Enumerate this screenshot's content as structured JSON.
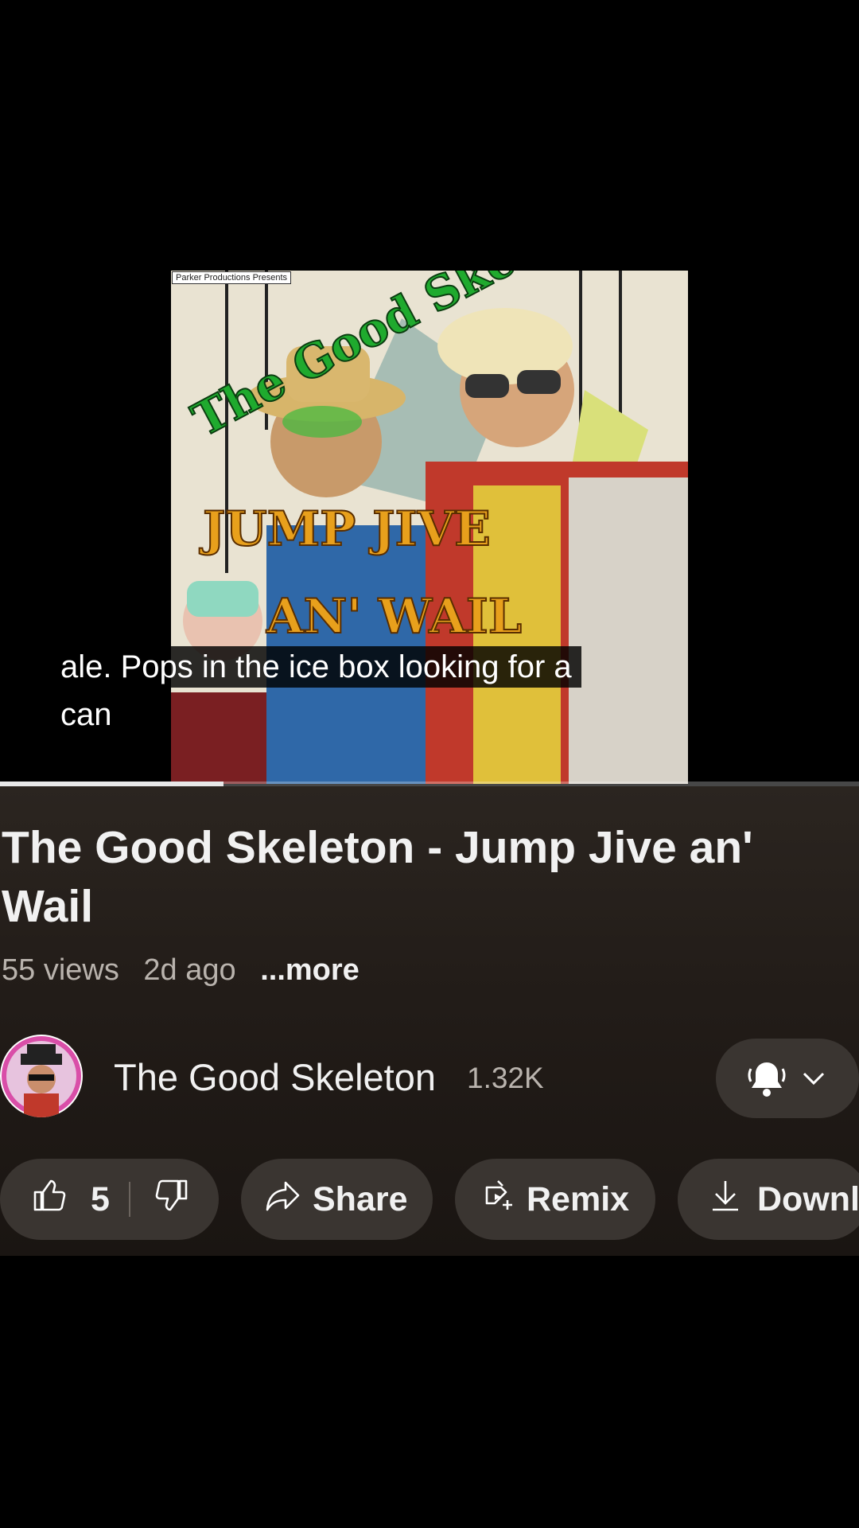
{
  "player": {
    "thumbnail": {
      "credit_text": "Parker Productions Presents",
      "band_name_art": "The Good Skeleton",
      "album_line1": "JUMP JIVE",
      "album_line2": "AN' WAIL"
    },
    "caption_line1": "ale. Pops in the ice box looking for a",
    "caption_line2": "can",
    "progress_fraction": 0.26
  },
  "video": {
    "title": "The Good Skeleton - Jump Jive an' Wail",
    "views": "55 views",
    "age": "2d ago",
    "more_label": "...more"
  },
  "channel": {
    "name": "The Good Skeleton",
    "subscribers": "1.32K",
    "bell_icon": "bell-ringing-icon",
    "chevron_icon": "chevron-down-icon"
  },
  "actions": {
    "like_count": "5",
    "share_label": "Share",
    "remix_label": "Remix",
    "download_label": "Downl"
  },
  "colors": {
    "background": "#000000",
    "info_bg": "#2b2520",
    "pill_bg": "#3a3531",
    "secondary_text": "#b9b3ad"
  }
}
